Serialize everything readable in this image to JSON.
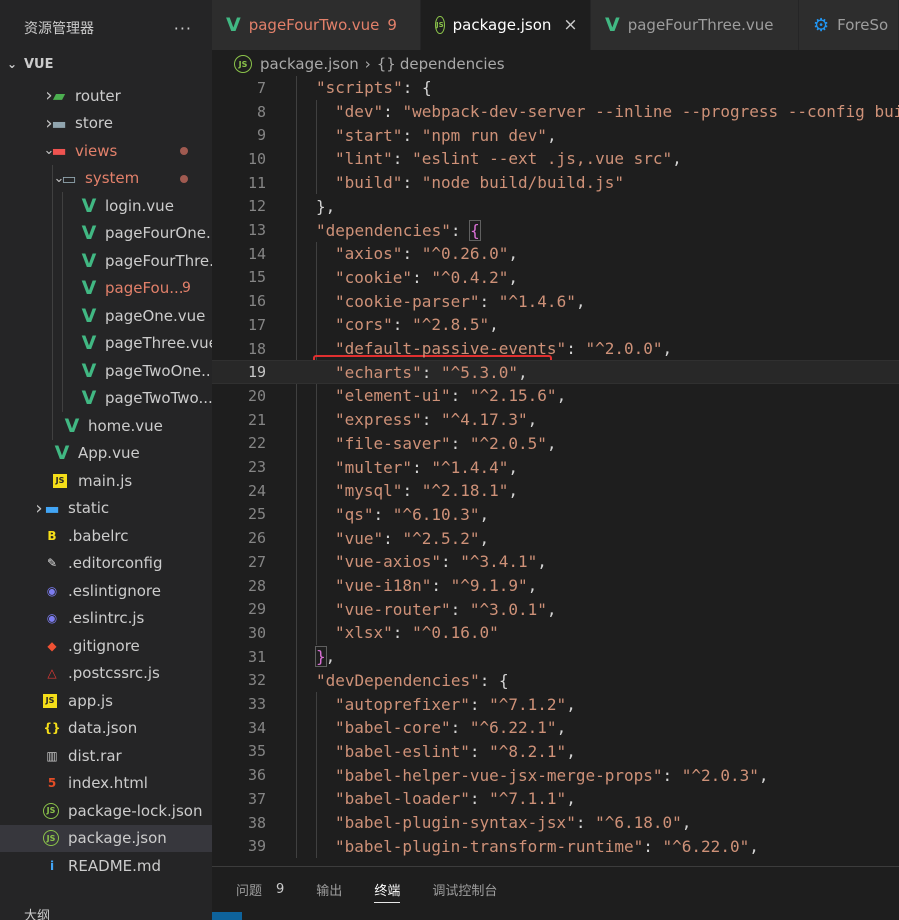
{
  "sidebar": {
    "title": "资源管理器",
    "more": "···",
    "section": "VUE",
    "tree": [
      {
        "label": "router",
        "indent": 1,
        "arrow": "›",
        "icon": "router-folder-icon",
        "iconColor": "#4caf50",
        "glyph": "▰",
        "modified": false
      },
      {
        "label": "store",
        "indent": 1,
        "arrow": "›",
        "icon": "folder-icon",
        "iconColor": "#90a4ae",
        "glyph": "▬",
        "modified": false
      },
      {
        "label": "views",
        "indent": 1,
        "arrow": "⌄",
        "icon": "views-folder-icon",
        "iconColor": "#ef5350",
        "glyph": "▬",
        "modified": true,
        "dot": true
      },
      {
        "label": "system",
        "indent": 2,
        "arrow": "⌄",
        "icon": "folder-open-icon",
        "iconColor": "#90a4ae",
        "glyph": "▭",
        "modified": true,
        "dot": true
      },
      {
        "label": "login.vue",
        "indent": 3,
        "icon": "vue-icon",
        "iconColor": "#41b883",
        "glyph": "V",
        "modified": false
      },
      {
        "label": "pageFourOne...",
        "indent": 3,
        "icon": "vue-icon",
        "iconColor": "#41b883",
        "glyph": "V",
        "modified": false
      },
      {
        "label": "pageFourThre...",
        "indent": 3,
        "icon": "vue-icon",
        "iconColor": "#41b883",
        "glyph": "V",
        "modified": false
      },
      {
        "label": "pageFou...",
        "indent": 3,
        "icon": "vue-icon",
        "iconColor": "#41b883",
        "glyph": "V",
        "modified": true,
        "badge": "9"
      },
      {
        "label": "pageOne.vue",
        "indent": 3,
        "icon": "vue-icon",
        "iconColor": "#41b883",
        "glyph": "V",
        "modified": false
      },
      {
        "label": "pageThree.vue",
        "indent": 3,
        "icon": "vue-icon",
        "iconColor": "#41b883",
        "glyph": "V",
        "modified": false
      },
      {
        "label": "pageTwoOne....",
        "indent": 3,
        "icon": "vue-icon",
        "iconColor": "#41b883",
        "glyph": "V",
        "modified": false
      },
      {
        "label": "pageTwoTwo....",
        "indent": 3,
        "icon": "vue-icon",
        "iconColor": "#41b883",
        "glyph": "V",
        "modified": false
      },
      {
        "label": "home.vue",
        "indent": 2,
        "icon": "vue-icon",
        "iconColor": "#41b883",
        "glyph": "V",
        "modified": false
      },
      {
        "label": "App.vue",
        "indent": 1,
        "icon": "vue-icon",
        "iconColor": "#41b883",
        "glyph": "V",
        "modified": false
      },
      {
        "label": "main.js",
        "indent": 1,
        "icon": "js-icon",
        "iconColor": "#f5de19",
        "glyph": "JS",
        "modified": false
      },
      {
        "label": "static",
        "indent": 0,
        "arrow": "›",
        "icon": "static-folder-icon",
        "iconColor": "#42a5f5",
        "glyph": "▬",
        "modified": false
      },
      {
        "label": ".babelrc",
        "indent": 0,
        "icon": "babel-icon",
        "iconColor": "#f5de19",
        "glyph": "B",
        "modified": false
      },
      {
        "label": ".editorconfig",
        "indent": 0,
        "icon": "editorconfig-icon",
        "iconColor": "#e0e0e0",
        "glyph": "✎",
        "modified": false
      },
      {
        "label": ".eslintignore",
        "indent": 0,
        "icon": "eslint-icon",
        "iconColor": "#7c7cf0",
        "glyph": "◉",
        "modified": false
      },
      {
        "label": ".eslintrc.js",
        "indent": 0,
        "icon": "eslint-icon",
        "iconColor": "#7c7cf0",
        "glyph": "◉",
        "modified": false
      },
      {
        "label": ".gitignore",
        "indent": 0,
        "icon": "git-icon",
        "iconColor": "#f05133",
        "glyph": "◆",
        "modified": false
      },
      {
        "label": ".postcssrc.js",
        "indent": 0,
        "icon": "postcss-icon",
        "iconColor": "#e53935",
        "glyph": "△",
        "modified": false
      },
      {
        "label": "app.js",
        "indent": 0,
        "icon": "js-icon",
        "iconColor": "#f5de19",
        "glyph": "JS",
        "modified": false
      },
      {
        "label": "data.json",
        "indent": 0,
        "icon": "json-icon",
        "iconColor": "#f5de19",
        "glyph": "{}",
        "modified": false
      },
      {
        "label": "dist.rar",
        "indent": 0,
        "icon": "archive-icon",
        "iconColor": "#c5c5c5",
        "glyph": "▥",
        "modified": false
      },
      {
        "label": "index.html",
        "indent": 0,
        "icon": "html-icon",
        "iconColor": "#e44d26",
        "glyph": "5",
        "modified": false
      },
      {
        "label": "package-lock.json",
        "indent": 0,
        "icon": "nodejs-icon",
        "iconColor": "#8bc34a",
        "glyph": "JS",
        "modified": false
      },
      {
        "label": "package.json",
        "indent": 0,
        "icon": "nodejs-icon",
        "iconColor": "#8bc34a",
        "glyph": "JS",
        "modified": false,
        "active": true
      },
      {
        "label": "README.md",
        "indent": 0,
        "icon": "info-icon",
        "iconColor": "#42a5f5",
        "glyph": "i",
        "modified": false
      }
    ],
    "bottom_label": "大纲"
  },
  "tabs": [
    {
      "label": "pageFourTwo.vue",
      "icon": "vue-icon",
      "iconColor": "#41b883",
      "glyph": "V",
      "badge": "9",
      "modified": true,
      "active": false
    },
    {
      "label": "package.json",
      "icon": "nodejs-icon",
      "iconColor": "#8bc34a",
      "glyph": "JS",
      "active": true,
      "close": "×"
    },
    {
      "label": "pageFourThree.vue",
      "icon": "vue-icon",
      "iconColor": "#41b883",
      "glyph": "V",
      "active": false
    },
    {
      "label": "ForeSo",
      "icon": "gear-icon",
      "iconColor": "#2196f3",
      "glyph": "⚙",
      "active": false
    }
  ],
  "breadcrumb": {
    "file": "package.json",
    "sep": "›",
    "symbol": "{}",
    "path": "dependencies"
  },
  "editor": {
    "current_line": 19,
    "lines": [
      {
        "n": "7",
        "indent": 1,
        "parts": [
          [
            "k",
            "\"scripts\""
          ],
          [
            "p",
            ": {"
          ]
        ]
      },
      {
        "n": "8",
        "indent": 2,
        "parts": [
          [
            "k",
            "\"dev\""
          ],
          [
            "p",
            ": "
          ],
          [
            "k",
            "\"webpack-dev-server --inline --progress --config bui"
          ]
        ]
      },
      {
        "n": "9",
        "indent": 2,
        "parts": [
          [
            "k",
            "\"start\""
          ],
          [
            "p",
            ": "
          ],
          [
            "k",
            "\"npm run dev\""
          ],
          [
            "p",
            ","
          ]
        ]
      },
      {
        "n": "10",
        "indent": 2,
        "parts": [
          [
            "k",
            "\"lint\""
          ],
          [
            "p",
            ": "
          ],
          [
            "k",
            "\"eslint --ext .js,.vue src\""
          ],
          [
            "p",
            ","
          ]
        ]
      },
      {
        "n": "11",
        "indent": 2,
        "parts": [
          [
            "k",
            "\"build\""
          ],
          [
            "p",
            ": "
          ],
          [
            "k",
            "\"node build/build.js\""
          ]
        ]
      },
      {
        "n": "12",
        "indent": 1,
        "parts": [
          [
            "p",
            "},"
          ]
        ]
      },
      {
        "n": "13",
        "indent": 1,
        "parts": [
          [
            "k",
            "\"dependencies\""
          ],
          [
            "p",
            ": "
          ],
          [
            "br",
            "{"
          ]
        ]
      },
      {
        "n": "14",
        "indent": 2,
        "parts": [
          [
            "k",
            "\"axios\""
          ],
          [
            "p",
            ": "
          ],
          [
            "k",
            "\"^0.26.0\""
          ],
          [
            "p",
            ","
          ]
        ]
      },
      {
        "n": "15",
        "indent": 2,
        "parts": [
          [
            "k",
            "\"cookie\""
          ],
          [
            "p",
            ": "
          ],
          [
            "k",
            "\"^0.4.2\""
          ],
          [
            "p",
            ","
          ]
        ]
      },
      {
        "n": "16",
        "indent": 2,
        "parts": [
          [
            "k",
            "\"cookie-parser\""
          ],
          [
            "p",
            ": "
          ],
          [
            "k",
            "\"^1.4.6\""
          ],
          [
            "p",
            ","
          ]
        ]
      },
      {
        "n": "17",
        "indent": 2,
        "parts": [
          [
            "k",
            "\"cors\""
          ],
          [
            "p",
            ": "
          ],
          [
            "k",
            "\"^2.8.5\""
          ],
          [
            "p",
            ","
          ]
        ]
      },
      {
        "n": "18",
        "indent": 2,
        "parts": [
          [
            "k",
            "\"default-passive-events\""
          ],
          [
            "p",
            ": "
          ],
          [
            "k",
            "\"^2.0.0\""
          ],
          [
            "p",
            ","
          ]
        ]
      },
      {
        "n": "19",
        "indent": 2,
        "parts": [
          [
            "k",
            "\"echarts\""
          ],
          [
            "p",
            ": "
          ],
          [
            "k",
            "\"^5.3.0\""
          ],
          [
            "p",
            ","
          ]
        ]
      },
      {
        "n": "20",
        "indent": 2,
        "parts": [
          [
            "k",
            "\"element-ui\""
          ],
          [
            "p",
            ": "
          ],
          [
            "k",
            "\"^2.15.6\""
          ],
          [
            "p",
            ","
          ]
        ]
      },
      {
        "n": "21",
        "indent": 2,
        "parts": [
          [
            "k",
            "\"express\""
          ],
          [
            "p",
            ": "
          ],
          [
            "k",
            "\"^4.17.3\""
          ],
          [
            "p",
            ","
          ]
        ]
      },
      {
        "n": "22",
        "indent": 2,
        "parts": [
          [
            "k",
            "\"file-saver\""
          ],
          [
            "p",
            ": "
          ],
          [
            "k",
            "\"^2.0.5\""
          ],
          [
            "p",
            ","
          ]
        ]
      },
      {
        "n": "23",
        "indent": 2,
        "parts": [
          [
            "k",
            "\"multer\""
          ],
          [
            "p",
            ": "
          ],
          [
            "k",
            "\"^1.4.4\""
          ],
          [
            "p",
            ","
          ]
        ]
      },
      {
        "n": "24",
        "indent": 2,
        "parts": [
          [
            "k",
            "\"mysql\""
          ],
          [
            "p",
            ": "
          ],
          [
            "k",
            "\"^2.18.1\""
          ],
          [
            "p",
            ","
          ]
        ]
      },
      {
        "n": "25",
        "indent": 2,
        "parts": [
          [
            "k",
            "\"qs\""
          ],
          [
            "p",
            ": "
          ],
          [
            "k",
            "\"^6.10.3\""
          ],
          [
            "p",
            ","
          ]
        ]
      },
      {
        "n": "26",
        "indent": 2,
        "parts": [
          [
            "k",
            "\"vue\""
          ],
          [
            "p",
            ": "
          ],
          [
            "k",
            "\"^2.5.2\""
          ],
          [
            "p",
            ","
          ]
        ]
      },
      {
        "n": "27",
        "indent": 2,
        "parts": [
          [
            "k",
            "\"vue-axios\""
          ],
          [
            "p",
            ": "
          ],
          [
            "k",
            "\"^3.4.1\""
          ],
          [
            "p",
            ","
          ]
        ]
      },
      {
        "n": "28",
        "indent": 2,
        "parts": [
          [
            "k",
            "\"vue-i18n\""
          ],
          [
            "p",
            ": "
          ],
          [
            "k",
            "\"^9.1.9\""
          ],
          [
            "p",
            ","
          ]
        ]
      },
      {
        "n": "29",
        "indent": 2,
        "parts": [
          [
            "k",
            "\"vue-router\""
          ],
          [
            "p",
            ": "
          ],
          [
            "k",
            "\"^3.0.1\""
          ],
          [
            "p",
            ","
          ]
        ]
      },
      {
        "n": "30",
        "indent": 2,
        "parts": [
          [
            "k",
            "\"xlsx\""
          ],
          [
            "p",
            ": "
          ],
          [
            "k",
            "\"^0.16.0\""
          ]
        ]
      },
      {
        "n": "31",
        "indent": 1,
        "parts": [
          [
            "br",
            "}"
          ],
          [
            "p",
            ","
          ]
        ]
      },
      {
        "n": "32",
        "indent": 1,
        "parts": [
          [
            "k",
            "\"devDependencies\""
          ],
          [
            "p",
            ": {"
          ]
        ]
      },
      {
        "n": "33",
        "indent": 2,
        "parts": [
          [
            "k",
            "\"autoprefixer\""
          ],
          [
            "p",
            ": "
          ],
          [
            "k",
            "\"^7.1.2\""
          ],
          [
            "p",
            ","
          ]
        ]
      },
      {
        "n": "34",
        "indent": 2,
        "parts": [
          [
            "k",
            "\"babel-core\""
          ],
          [
            "p",
            ": "
          ],
          [
            "k",
            "\"^6.22.1\""
          ],
          [
            "p",
            ","
          ]
        ]
      },
      {
        "n": "35",
        "indent": 2,
        "parts": [
          [
            "k",
            "\"babel-eslint\""
          ],
          [
            "p",
            ": "
          ],
          [
            "k",
            "\"^8.2.1\""
          ],
          [
            "p",
            ","
          ]
        ]
      },
      {
        "n": "36",
        "indent": 2,
        "parts": [
          [
            "k",
            "\"babel-helper-vue-jsx-merge-props\""
          ],
          [
            "p",
            ": "
          ],
          [
            "k",
            "\"^2.0.3\""
          ],
          [
            "p",
            ","
          ]
        ]
      },
      {
        "n": "37",
        "indent": 2,
        "parts": [
          [
            "k",
            "\"babel-loader\""
          ],
          [
            "p",
            ": "
          ],
          [
            "k",
            "\"^7.1.1\""
          ],
          [
            "p",
            ","
          ]
        ]
      },
      {
        "n": "38",
        "indent": 2,
        "parts": [
          [
            "k",
            "\"babel-plugin-syntax-jsx\""
          ],
          [
            "p",
            ": "
          ],
          [
            "k",
            "\"^6.18.0\""
          ],
          [
            "p",
            ","
          ]
        ]
      },
      {
        "n": "39",
        "indent": 2,
        "parts": [
          [
            "k",
            "\"babel-plugin-transform-runtime\""
          ],
          [
            "p",
            ": "
          ],
          [
            "k",
            "\"^6.22.0\""
          ],
          [
            "p",
            ","
          ]
        ]
      }
    ]
  },
  "panel": {
    "tabs": [
      {
        "label": "问题",
        "count": "9",
        "active": false
      },
      {
        "label": "输出",
        "active": false
      },
      {
        "label": "终端",
        "active": true
      },
      {
        "label": "调试控制台",
        "active": false
      }
    ]
  },
  "colors": {
    "key": "#ce9178",
    "string": "#ce9178",
    "punct": "#d4d4d4",
    "bracket": "#da70d6",
    "highlight": "#e03030"
  }
}
